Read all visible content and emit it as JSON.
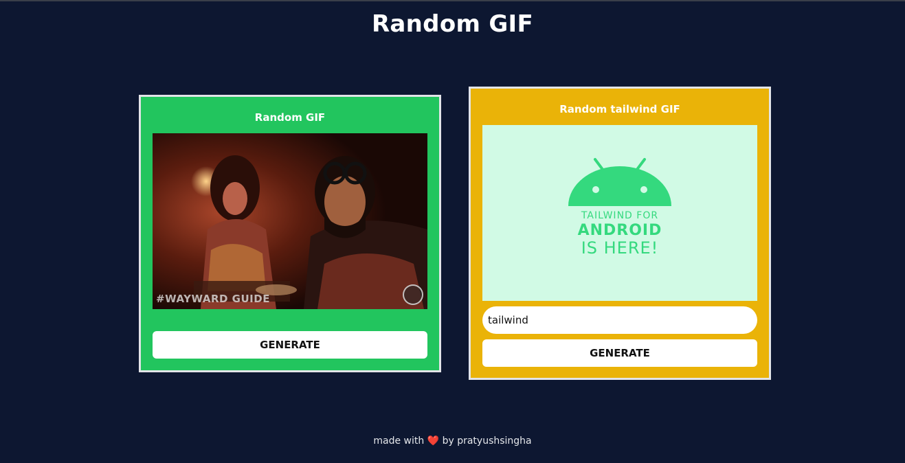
{
  "page": {
    "title": "Random GIF"
  },
  "random_card": {
    "title": "Random GIF",
    "gif_watermark": "#WAYWARD GUIDE",
    "generate_label": "GENERATE",
    "color": "#22c55e"
  },
  "tag_card": {
    "title": "Random tailwind GIF",
    "gif_lines": [
      "TAILWIND FOR",
      "ANDROID",
      "IS HERE!"
    ],
    "tag_value": "tailwind",
    "generate_label": "GENERATE",
    "color": "#eab308"
  },
  "footer": {
    "prefix": "made with",
    "heart": "❤️",
    "suffix": "by pratyushsingha"
  },
  "colors": {
    "background": "#0d1731",
    "android_green": "#34d97e",
    "gif_background": "#d1fae5"
  }
}
